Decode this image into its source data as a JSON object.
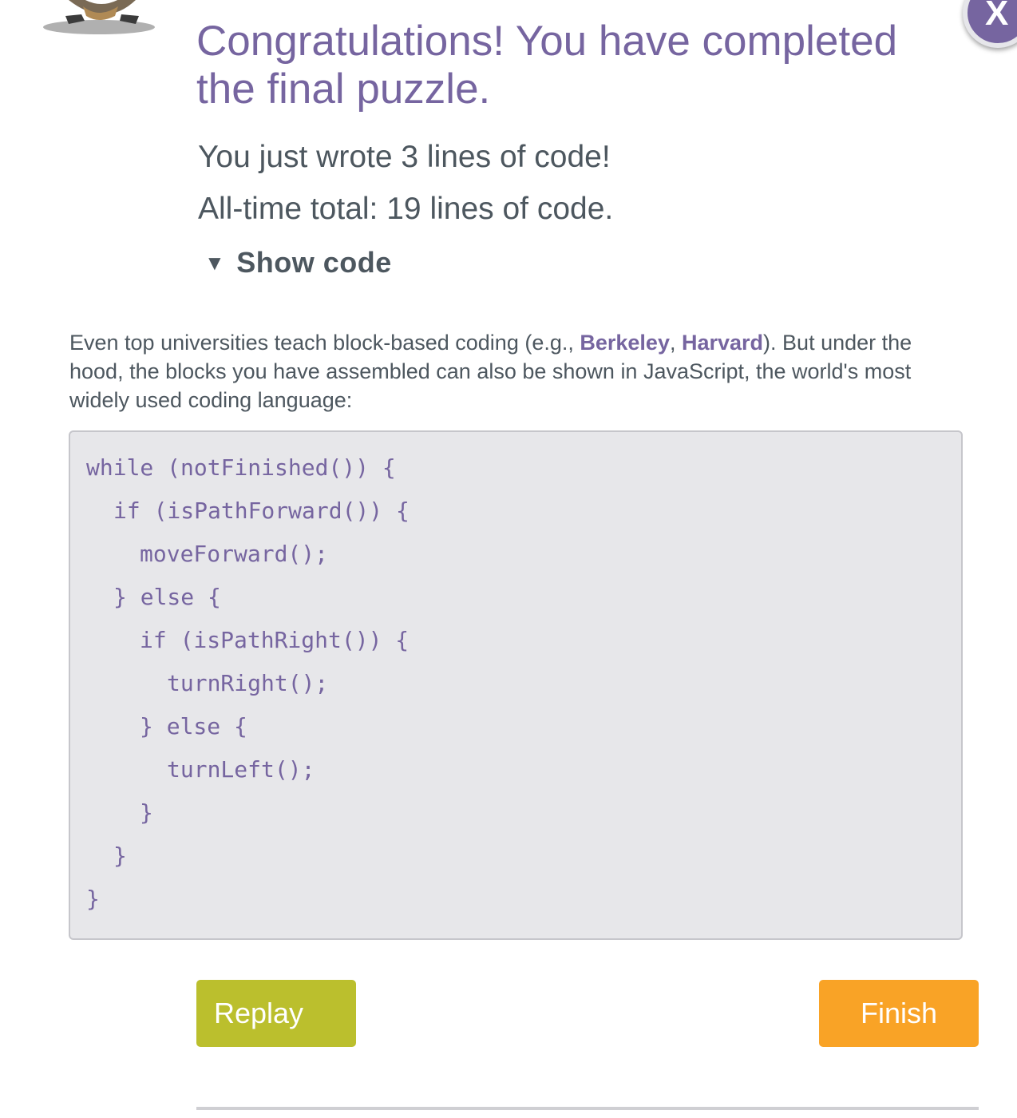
{
  "header": {
    "avatar_icon": "character-avatar-icon",
    "close_label": "X",
    "close_color": "#7665a0"
  },
  "dialog": {
    "headline": "Congratulations! You have completed the final puzzle.",
    "lines_written": "You just wrote 3 lines of code!",
    "all_time_total": "All-time total: 19 lines of code.",
    "show_code_icon": "triangle-down-icon",
    "show_code_label": "Show code"
  },
  "description": {
    "text_before": "Even top universities teach block-based coding (e.g., ",
    "link1": "Berkeley",
    "separator": ", ",
    "link2": "Harvard",
    "text_after": "). But under the hood, the blocks you have assembled can also be shown in JavaScript, the world's most widely used coding language:"
  },
  "code": {
    "lines": [
      "while (notFinished()) {",
      "if (isPathForward()) {",
      "moveForward();",
      "} else {",
      "if (isPathRight()) {",
      "turnRight();",
      "} else {",
      "turnLeft();",
      "}",
      "}",
      "}"
    ]
  },
  "buttons": {
    "replay_label": "Replay",
    "finish_label": "Finish"
  },
  "colors": {
    "accent_purple": "#7665a0",
    "text_gray": "#4d575f",
    "replay_green": "#bbbf2d",
    "finish_orange": "#f9a326",
    "code_background": "#e7e7ea"
  }
}
